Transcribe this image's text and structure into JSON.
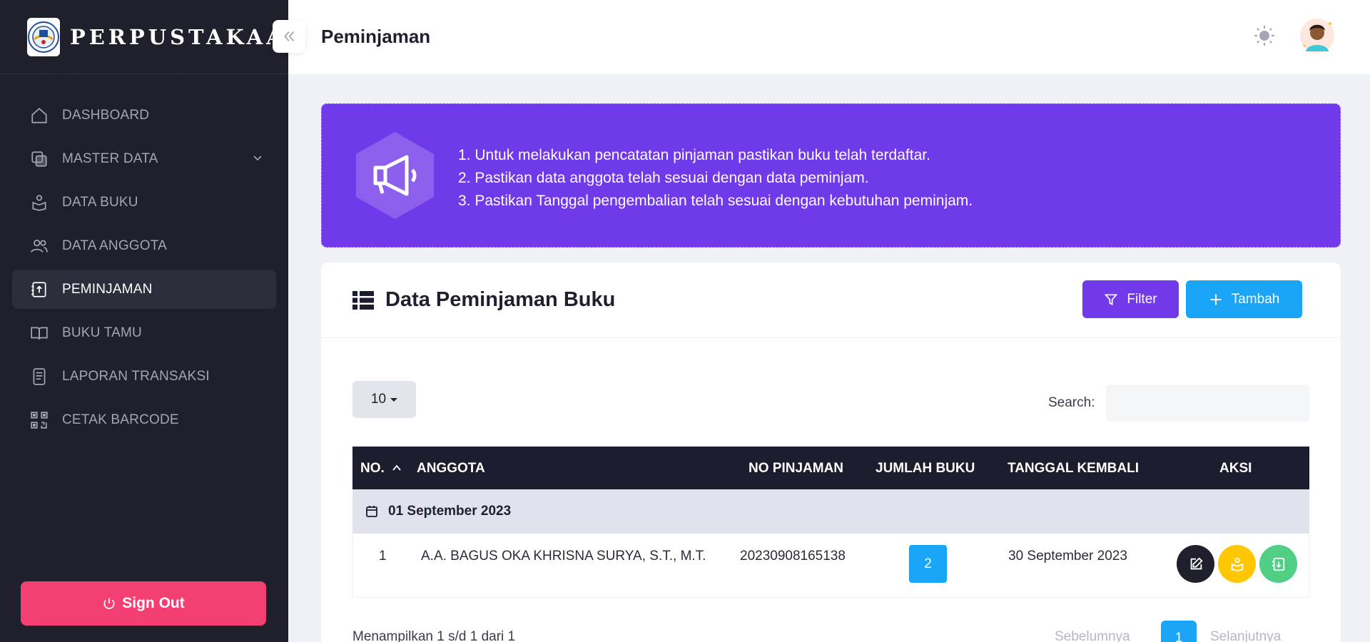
{
  "sidebar": {
    "brand": "PERPUSTAKAAN",
    "items": [
      {
        "label": "DASHBOARD",
        "icon": "home-icon"
      },
      {
        "label": "MASTER DATA",
        "icon": "layers-icon"
      },
      {
        "label": "DATA BUKU",
        "icon": "book-reader-icon"
      },
      {
        "label": "DATA ANGGOTA",
        "icon": "users-icon"
      },
      {
        "label": "PEMINJAMAN",
        "icon": "upload-doc-icon"
      },
      {
        "label": "BUKU TAMU",
        "icon": "open-book-icon"
      },
      {
        "label": "LAPORAN TRANSAKSI",
        "icon": "document-icon"
      },
      {
        "label": "CETAK BARCODE",
        "icon": "qrcode-icon"
      }
    ],
    "active": "PEMINJAMAN",
    "signout_label": "Sign Out"
  },
  "header": {
    "title": "Peminjaman"
  },
  "banner": {
    "notes": [
      "1. Untuk melakukan pencatatan pinjaman pastikan buku telah terdaftar.",
      "2. Pastikan data anggota telah sesuai dengan data peminjam.",
      "3. Pastikan Tanggal pengembalian telah sesuai dengan kebutuhan peminjam."
    ]
  },
  "card": {
    "title": "Data Peminjaman Buku",
    "filter_label": "Filter",
    "add_label": "Tambah"
  },
  "table_controls": {
    "page_length": "10",
    "search_label": "Search:",
    "search_value": ""
  },
  "table": {
    "columns": [
      "NO.",
      "ANGGOTA",
      "NO PINJAMAN",
      "JUMLAH BUKU",
      "TANGGAL KEMBALI",
      "AKSI"
    ],
    "groups": [
      {
        "date": "01 September 2023",
        "rows": [
          {
            "no": "1",
            "anggota": "A.A. BAGUS OKA KHRISNA SURYA, S.T., M.T.",
            "no_pinjaman": "20230908165138",
            "jumlah_buku": "2",
            "tanggal_kembali": "30 September 2023"
          }
        ]
      }
    ]
  },
  "pagination": {
    "info": "Menampilkan 1 s/d 1 dari 1",
    "prev_label": "Sebelumnya",
    "current_page": "1",
    "next_label": "Selanjutnya"
  },
  "colors": {
    "sidebar_bg": "#1f202c",
    "banner_bg": "#7039e9",
    "primary": "#1ba5f6",
    "purple": "#7239ea",
    "danger": "#f33f71",
    "warning": "#ffc702",
    "success": "#4fce84"
  }
}
